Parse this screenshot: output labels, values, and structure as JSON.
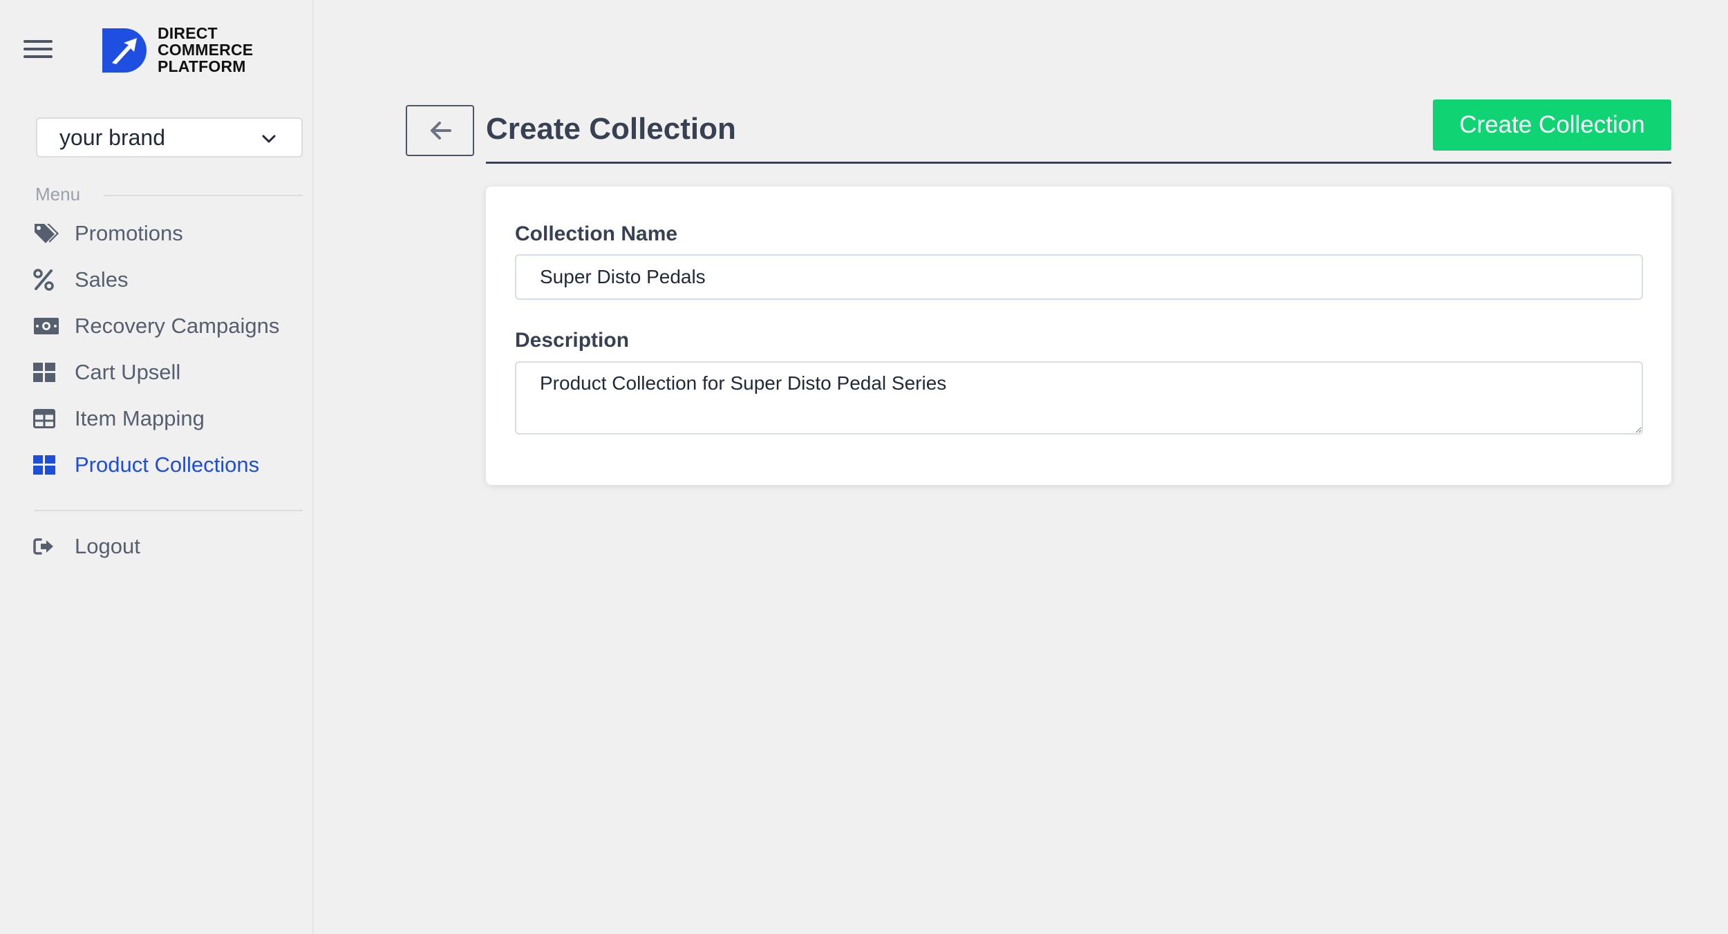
{
  "sidebar": {
    "logo": {
      "line1": "DIRECT",
      "line2": "COMMERCE",
      "line3": "PLATFORM"
    },
    "brand_select": {
      "value": "your brand"
    },
    "menu_label": "Menu",
    "items": [
      {
        "label": "Promotions",
        "icon": "tags-icon",
        "active": false
      },
      {
        "label": "Sales",
        "icon": "percent-icon",
        "active": false
      },
      {
        "label": "Recovery Campaigns",
        "icon": "money-bill-icon",
        "active": false
      },
      {
        "label": "Cart Upsell",
        "icon": "grid-icon",
        "active": false
      },
      {
        "label": "Item Mapping",
        "icon": "table-icon",
        "active": false
      },
      {
        "label": "Product Collections",
        "icon": "grid-icon",
        "active": true
      }
    ],
    "logout_label": "Logout"
  },
  "header": {
    "title": "Create Collection",
    "primary_button_label": "Create Collection"
  },
  "form": {
    "collection_name_label": "Collection Name",
    "collection_name_value": "Super Disto Pedals",
    "description_label": "Description",
    "description_value": "Product Collection for Super Disto Pedal Series"
  },
  "colors": {
    "accent": "#10d474",
    "active_nav": "#1d4ed8",
    "logo_blue": "#1f4fe0"
  }
}
